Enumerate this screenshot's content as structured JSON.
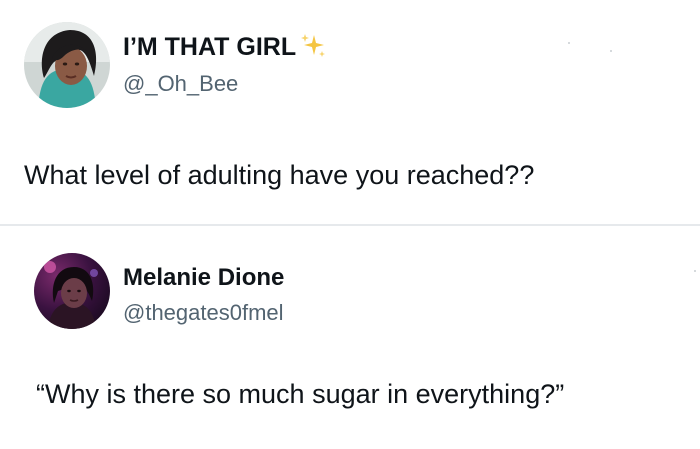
{
  "tweets": [
    {
      "display_name": "I’M THAT GIRL",
      "handle": "@_Oh_Bee",
      "text": "What level of adulting have you reached??",
      "avatar_icon": "profile-photo-woman-dark-hair",
      "badge_icon": "sparkles-icon"
    },
    {
      "display_name": "Melanie Dione",
      "handle": "@thegates0fmel",
      "text": "“Why is there so much sugar in everything?”",
      "avatar_icon": "profile-photo-woman-purple-light"
    }
  ],
  "colors": {
    "text": "#0f1419",
    "handle": "#536471",
    "divider": "#e6e9ec",
    "sparkle": "#f4c542"
  }
}
